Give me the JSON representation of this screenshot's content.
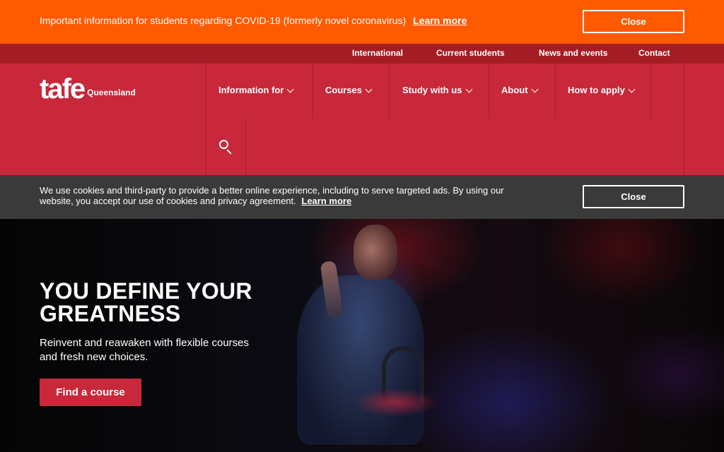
{
  "alert": {
    "text": "Important information for students regarding COVID-19 (formerly novel coronavirus)",
    "link": "Learn more",
    "close_label": "Close"
  },
  "utility_nav": [
    "International",
    "Current students",
    "News and events",
    "Contact"
  ],
  "logo": {
    "main": "tafe",
    "sub": "Queensland"
  },
  "main_nav": [
    "Information for",
    "Courses",
    "Study with us",
    "About",
    "How to apply"
  ],
  "cookie": {
    "text": "We use cookies and third-party to provide a better online experience, including to serve targeted ads. By using our website, you accept our use of cookies and privacy agreement.",
    "link": "Learn more",
    "close_label": "Close"
  },
  "hero": {
    "title": "YOU DEFINE YOUR GREATNESS",
    "subtitle": "Reinvent and reawaken with flexible courses and fresh new choices.",
    "cta": "Find a course"
  },
  "colors": {
    "alert_bg": "#ff5a00",
    "utility_bg": "#a51d24",
    "header_bg": "#c8283a",
    "cookie_bg": "#3a3a3a",
    "cta_bg": "#c8283a"
  },
  "icons": [
    "search-icon",
    "chevron-down-icon"
  ]
}
